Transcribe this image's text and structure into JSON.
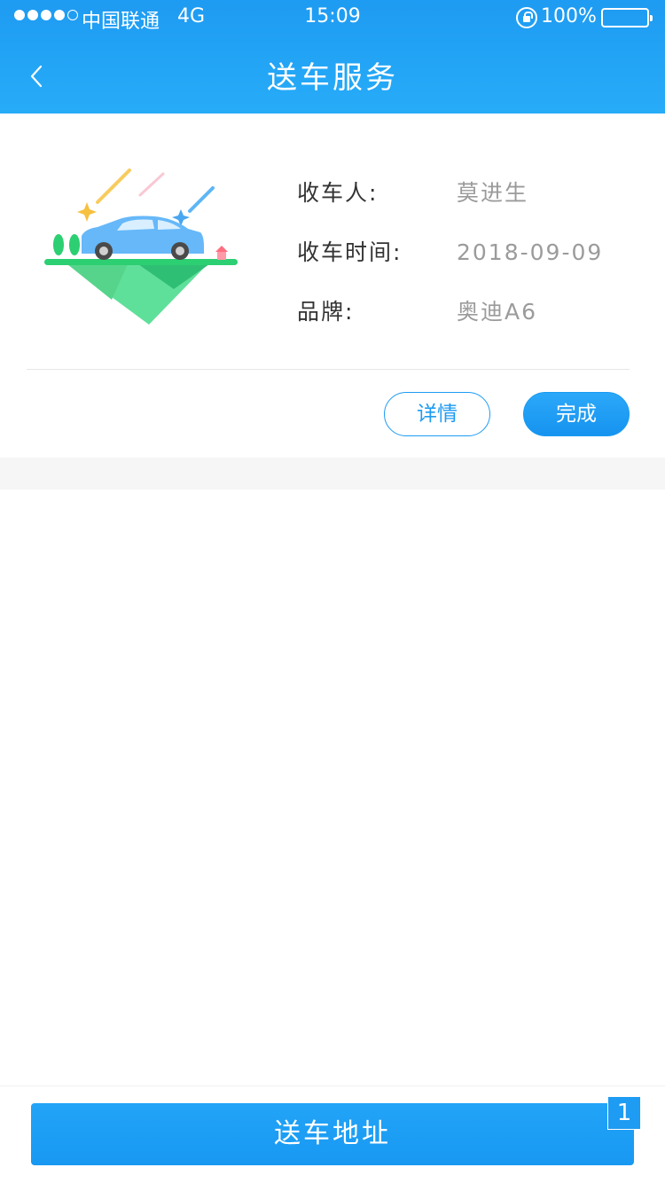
{
  "status_bar": {
    "carrier": "中国联通",
    "network": "4G",
    "time": "15:09",
    "battery": "100%"
  },
  "header": {
    "title": "送车服务",
    "back_icon": "chevron-left-icon"
  },
  "card": {
    "receiver_label": "收车人:",
    "receiver_value": "莫进生",
    "time_label": "收车时间:",
    "time_value": "2018-09-09",
    "brand_label": "品牌:",
    "brand_value": "奥迪A6",
    "detail_button": "详情",
    "done_button": "完成"
  },
  "footer": {
    "address_button": "送车地址",
    "badge": "1"
  },
  "colors": {
    "primary": "#1e9bf2",
    "header_gradient_end": "#27acf8",
    "value_gray": "#9b9b9b",
    "label_dark": "#333333"
  }
}
